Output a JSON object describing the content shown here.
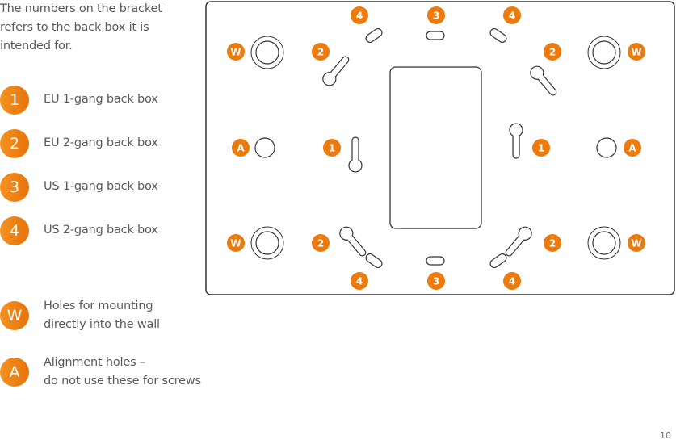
{
  "intro": {
    "lines": [
      "The numbers on the bracket",
      "refers to the back box it is",
      "intended for."
    ]
  },
  "legend": [
    {
      "key": "1",
      "lines": [
        "EU 1-gang back box"
      ]
    },
    {
      "key": "2",
      "lines": [
        "EU 2-gang back box"
      ]
    },
    {
      "key": "3",
      "lines": [
        "US 1-gang back box"
      ]
    },
    {
      "key": "4",
      "lines": [
        "US 2-gang back box"
      ]
    },
    {
      "key": "W",
      "lines": [
        "Holes for mounting",
        "directly into the wall"
      ]
    },
    {
      "key": "A",
      "lines": [
        "Alignment holes –",
        "do not use these for screws"
      ]
    }
  ],
  "diagram": {
    "accent_color": "#ec7a0d",
    "badges": {
      "top_4_left": "4",
      "top_3": "3",
      "top_4_right": "4",
      "top_w_left": "W",
      "top_2_left": "2",
      "top_2_right": "2",
      "top_w_right": "W",
      "mid_a_left": "A",
      "mid_1_left": "1",
      "mid_1_right": "1",
      "mid_a_right": "A",
      "bot_w_left": "W",
      "bot_2_left": "2",
      "bot_2_right": "2",
      "bot_w_right": "W",
      "bot_4_left": "4",
      "bot_3": "3",
      "bot_4_right": "4"
    }
  },
  "page_number": "10"
}
